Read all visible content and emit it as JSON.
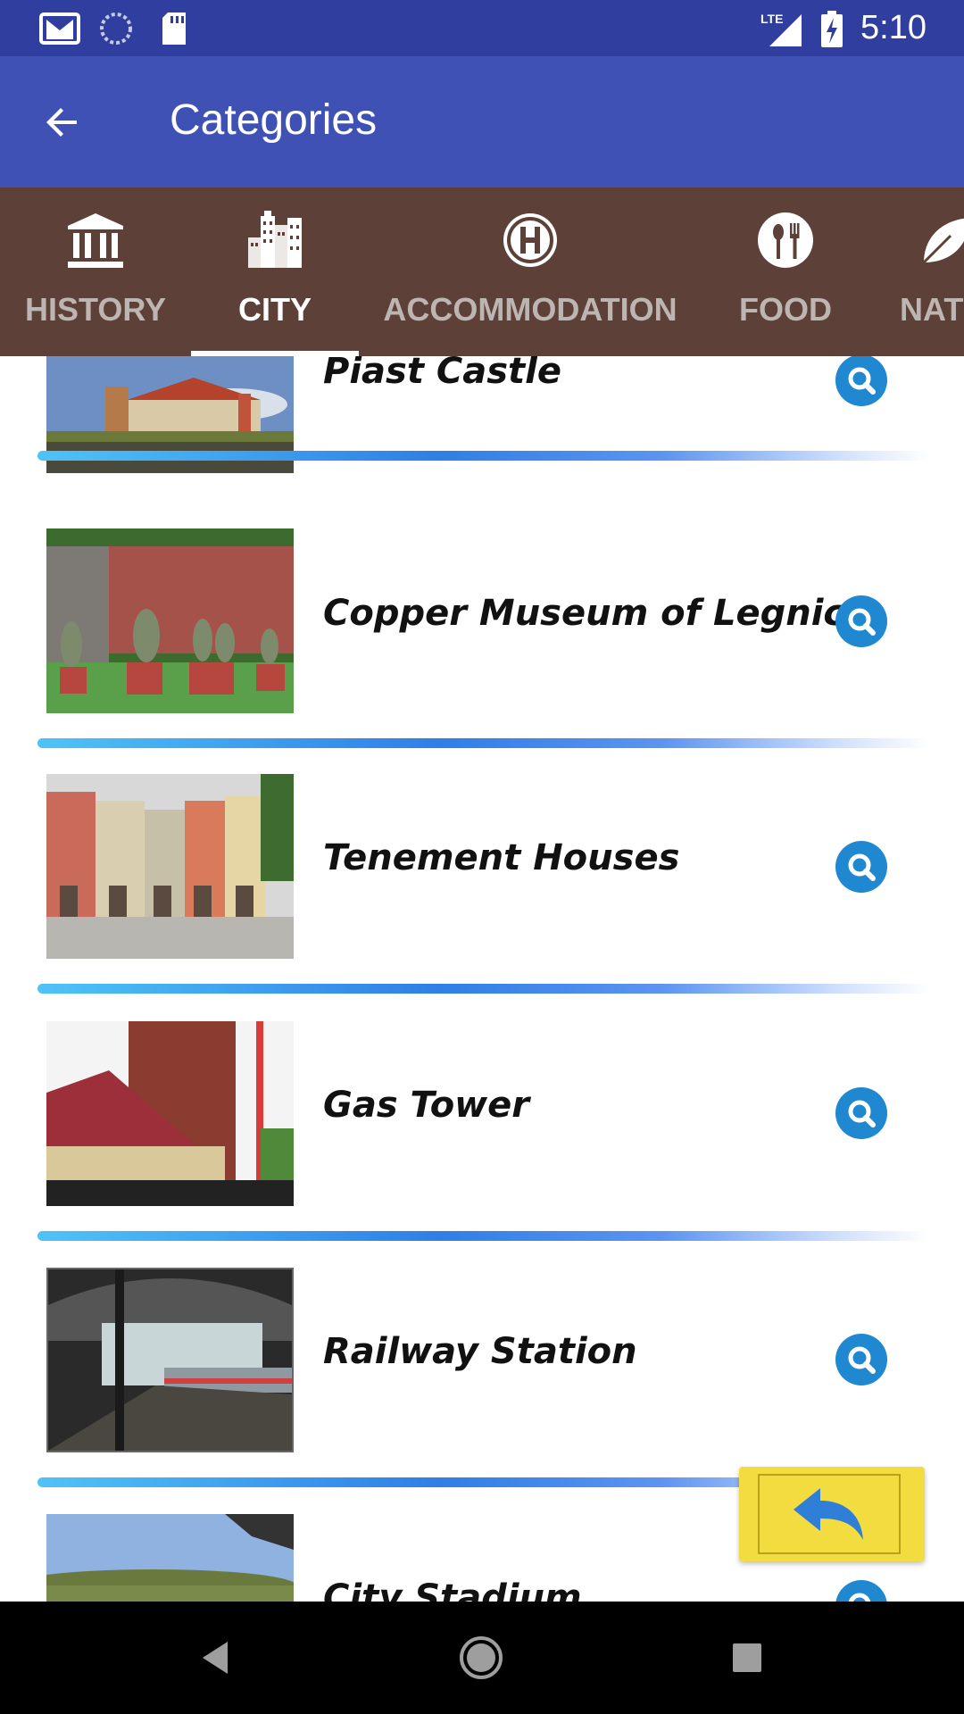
{
  "status_bar": {
    "time": "5:10",
    "network": "LTE",
    "icons": [
      "gmail-icon",
      "sync-icon",
      "sd-card-icon",
      "signal-icon",
      "battery-charging-icon"
    ]
  },
  "app_bar": {
    "title": "Categories",
    "back_icon": "arrow-back-icon"
  },
  "tabs": [
    {
      "label": "HISTORY",
      "icon": "museum-icon",
      "active": false
    },
    {
      "label": "CITY",
      "icon": "city-icon",
      "active": true
    },
    {
      "label": "ACCOMMODATION",
      "icon": "hotel-icon",
      "active": false
    },
    {
      "label": "FOOD",
      "icon": "food-icon",
      "active": false
    },
    {
      "label": "NAT",
      "icon": "leaf-icon",
      "active": false
    }
  ],
  "items": [
    {
      "title": "Piast Castle",
      "image": "castle-photo"
    },
    {
      "title": "Copper Museum of Legnica",
      "image": "museum-sculptures-photo"
    },
    {
      "title": "Tenement Houses",
      "image": "tenement-houses-photo"
    },
    {
      "title": "Gas Tower",
      "image": "gas-tower-photo"
    },
    {
      "title": "Railway Station",
      "image": "railway-station-photo"
    },
    {
      "title": "City Stadium",
      "image": "stadium-photo"
    }
  ],
  "fab": {
    "icon": "reply-arrow-icon"
  },
  "nav_bar": {
    "icons": [
      "nav-back-icon",
      "nav-home-icon",
      "nav-recents-icon"
    ]
  },
  "colors": {
    "status_bar": "#303f9f",
    "app_bar": "#3f51b5",
    "tab_bar": "#5d4037",
    "zoom_button": "#1f88d0",
    "fab": "#f2dc3f"
  }
}
